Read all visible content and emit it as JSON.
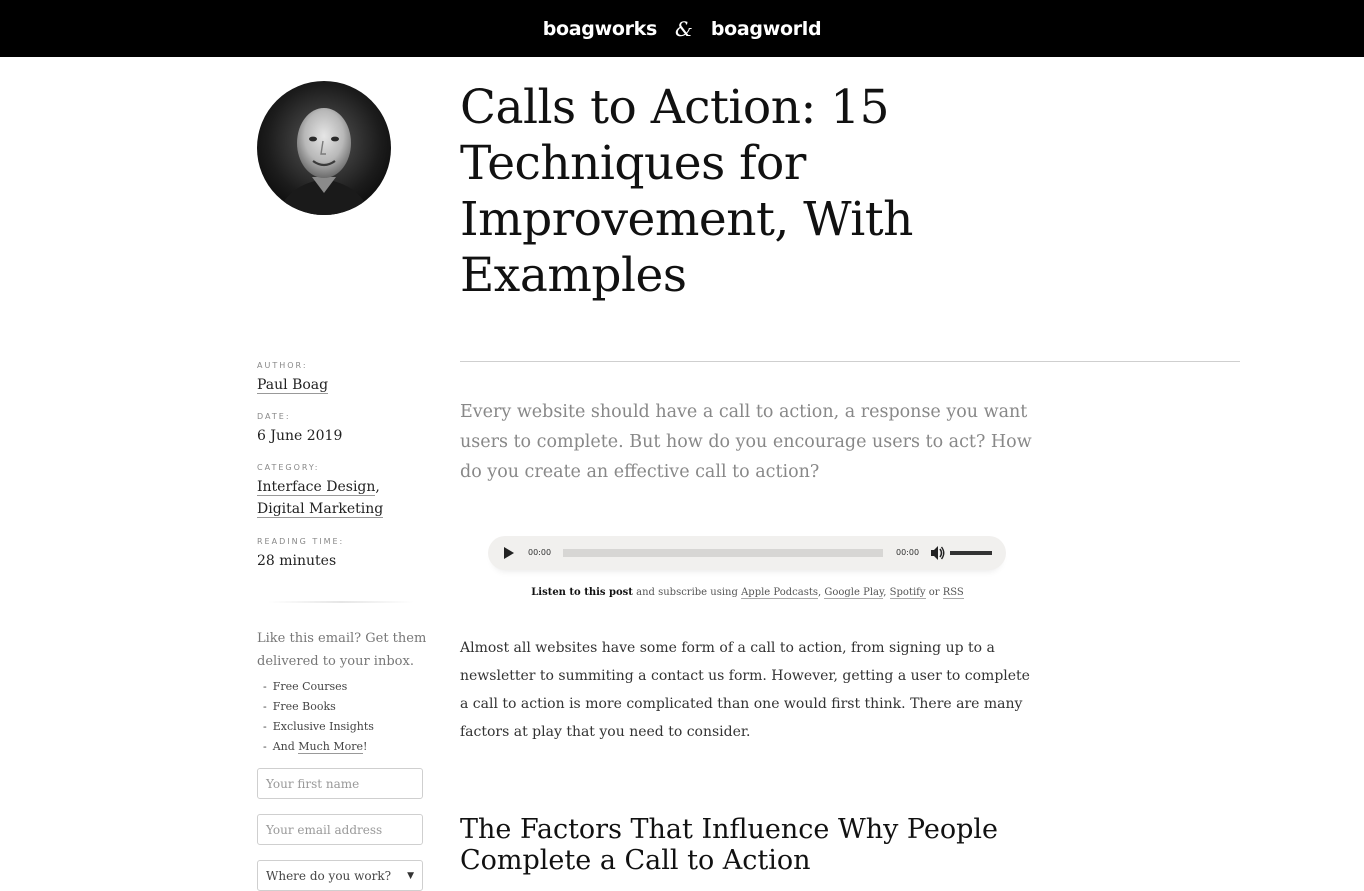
{
  "header": {
    "brand_left": "boagworks",
    "amp": "&",
    "brand_right": "boagworld"
  },
  "article": {
    "title": "Calls to Action: 15 Techniques for Improvement, With Examples",
    "intro": "Every website should have a call to action, a response you want users to complete. But how do you encourage users to act? How do you create an effective call to action?",
    "body": "Almost all websites have some form of a call to action, from signing up to a newsletter to summiting a contact us form. However, getting a user to complete a call to action is more complicated than one would first think. There are many factors at play that you need to consider.",
    "subheading": "The Factors That Influence Why People Complete a Call to Action"
  },
  "meta": {
    "author_label": "Author:",
    "author": "Paul Boag",
    "date_label": "Date:",
    "date": "6 June 2019",
    "category_label": "Category:",
    "category_1": "Interface Design",
    "category_sep": ",",
    "category_2": "Digital Marketing",
    "reading_label": "Reading time:",
    "reading": "28 minutes"
  },
  "player": {
    "current": "00:00",
    "duration": "00:00",
    "progress": 0
  },
  "listen": {
    "bold": "Listen to this post",
    "text": "and subscribe using",
    "apple": "Apple Podcasts",
    "google": "Google Play",
    "spotify": "Spotify",
    "or": "or",
    "rss": "RSS"
  },
  "signup": {
    "promo": "Like this email? Get them delivered to your inbox.",
    "perks": [
      "Free Courses",
      "Free Books",
      "Exclusive Insights"
    ],
    "perk_last_prefix": "And",
    "perk_last_link": "Much More",
    "perk_last_suffix": "!",
    "first_name_placeholder": "Your first name",
    "email_placeholder": "Your email address",
    "work_placeholder": "Where do you work?"
  }
}
